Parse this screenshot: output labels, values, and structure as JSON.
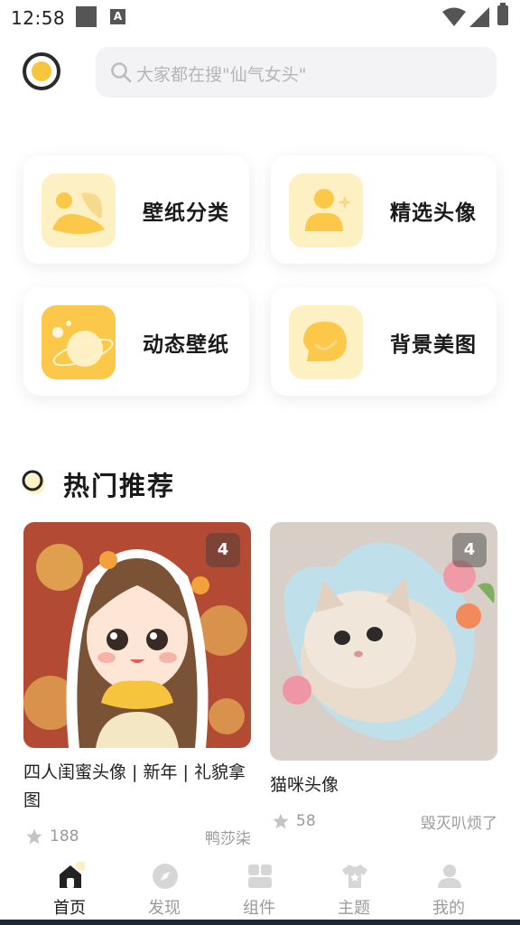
{
  "status_bar": {
    "time": "12:58",
    "notification_icons": [
      "square-icon",
      "a-icon"
    ],
    "indicators": [
      "wifi-icon",
      "signal-icon",
      "battery-icon"
    ]
  },
  "header": {
    "search_placeholder": "大家都在搜\"仙气女头\""
  },
  "categories": [
    {
      "label": "壁纸分类",
      "icon": "image-category-icon"
    },
    {
      "label": "精选头像",
      "icon": "avatar-icon"
    },
    {
      "label": "动态壁纸",
      "icon": "planet-icon"
    },
    {
      "label": "背景美图",
      "icon": "chat-bubble-icon"
    }
  ],
  "section": {
    "title": "热门推荐"
  },
  "posts": [
    {
      "title": "四人闺蜜头像 | 新年 | 礼貌拿图",
      "count_badge": "4",
      "stars": "188",
      "author": "鸭莎柒"
    },
    {
      "title": "猫咪头像",
      "count_badge": "4",
      "stars": "58",
      "author": "毁灭叭烦了"
    }
  ],
  "nav": [
    {
      "label": "首页",
      "icon": "home-icon",
      "active": true
    },
    {
      "label": "发现",
      "icon": "compass-icon",
      "active": false
    },
    {
      "label": "组件",
      "icon": "widgets-icon",
      "active": false
    },
    {
      "label": "主题",
      "icon": "tshirt-icon",
      "active": false
    },
    {
      "label": "我的",
      "icon": "person-icon",
      "active": false
    }
  ],
  "colors": {
    "accent_yellow": "#fbc84a",
    "light_yellow": "#fdf1c4",
    "muted_text": "#9a9a9a"
  }
}
